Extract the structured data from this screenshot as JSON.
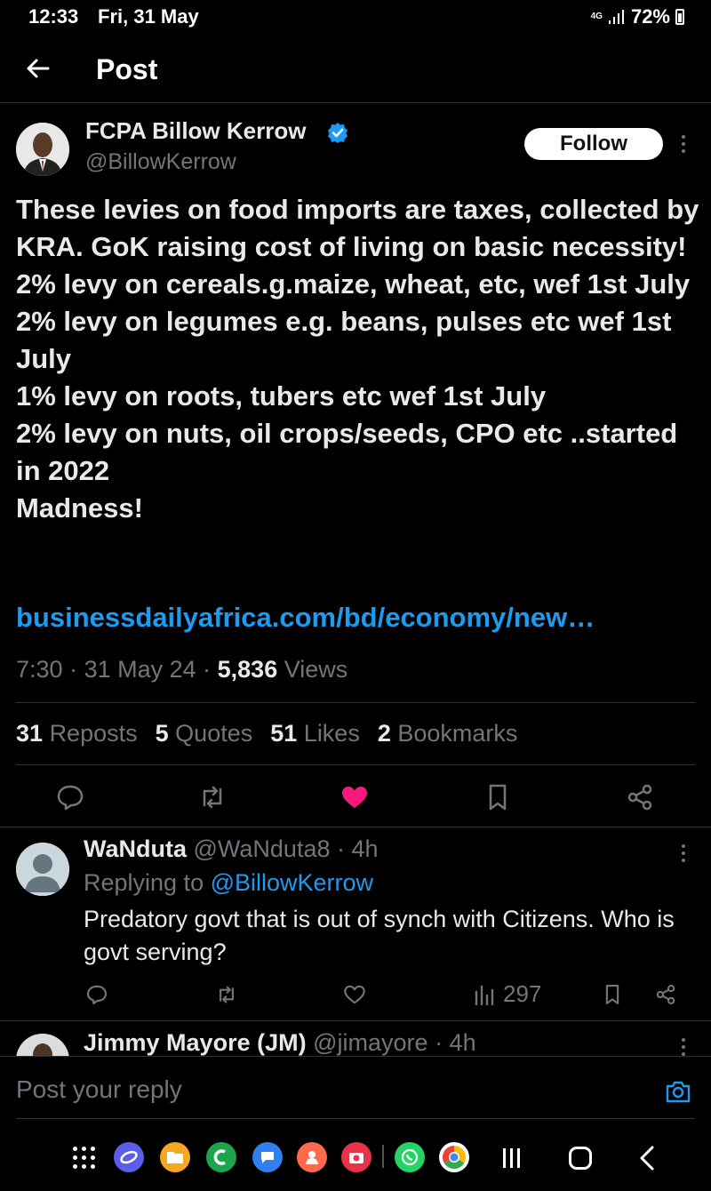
{
  "status_bar": {
    "time": "12:33",
    "date": "Fri, 31 May",
    "network": "4G",
    "battery": "72%"
  },
  "header": {
    "title": "Post"
  },
  "post": {
    "author_name": "FCPA Billow Kerrow",
    "author_handle": "@BillowKerrow",
    "follow_label": "Follow",
    "text": "These levies on food imports are taxes, collected by KRA. GoK raising cost of living on basic necessity!\n2% levy on cereals.g.maize, wheat, etc, wef 1st July\n2% levy on legumes e.g. beans, pulses etc wef 1st July\n1% levy on roots, tubers etc wef 1st July\n2% levy on nuts, oil crops/seeds, CPO etc ..started in 2022\nMadness!",
    "link": "businessdailyafrica.com/bd/economy/new…",
    "time": "7:30",
    "date": "31 May 24",
    "views_count": "5,836",
    "views_label": "Views",
    "reposts_count": "31",
    "reposts_label": "Reposts",
    "quotes_count": "5",
    "quotes_label": "Quotes",
    "likes_count": "51",
    "likes_label": "Likes",
    "bookmarks_count": "2",
    "bookmarks_label": "Bookmarks"
  },
  "replies": [
    {
      "name": "WaNduta",
      "handle": "@WaNduta8",
      "time": "· 4h",
      "replying_prefix": "Replying to",
      "replying_to": "@BillowKerrow",
      "text": "Predatory govt that is out of synch with Citizens. Who is govt serving?",
      "views": "297"
    },
    {
      "name": "Jimmy Mayore (JM)",
      "handle": "@jimayore",
      "time": "· 4h"
    }
  ],
  "reply_bar": {
    "placeholder": "Post your reply"
  },
  "colors": {
    "accent": "#1d9bf0",
    "like": "#f91880",
    "background": "#000000",
    "muted": "#71767b"
  }
}
